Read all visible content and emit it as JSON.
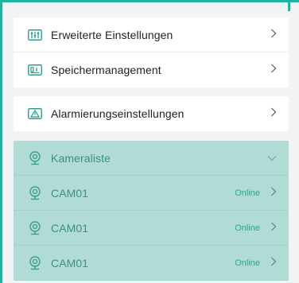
{
  "settings_card": {
    "items": [
      {
        "label": "Erweiterte Einstellungen",
        "icon": "sliders-icon"
      },
      {
        "label": "Speichermanagement",
        "icon": "storage-icon"
      }
    ]
  },
  "alarm_card": {
    "label": "Alarmierungseinstellungen",
    "icon": "warning-icon"
  },
  "camera_list": {
    "header_label": "Kameraliste",
    "header_icon": "camera-icon",
    "cameras": [
      {
        "name": "CAM01",
        "status": "Online"
      },
      {
        "name": "CAM01",
        "status": "Online"
      },
      {
        "name": "CAM01",
        "status": "Online"
      }
    ]
  },
  "colors": {
    "accent": "#20b3a0",
    "highlight": "#b1dcd5",
    "status": "#22a892"
  }
}
